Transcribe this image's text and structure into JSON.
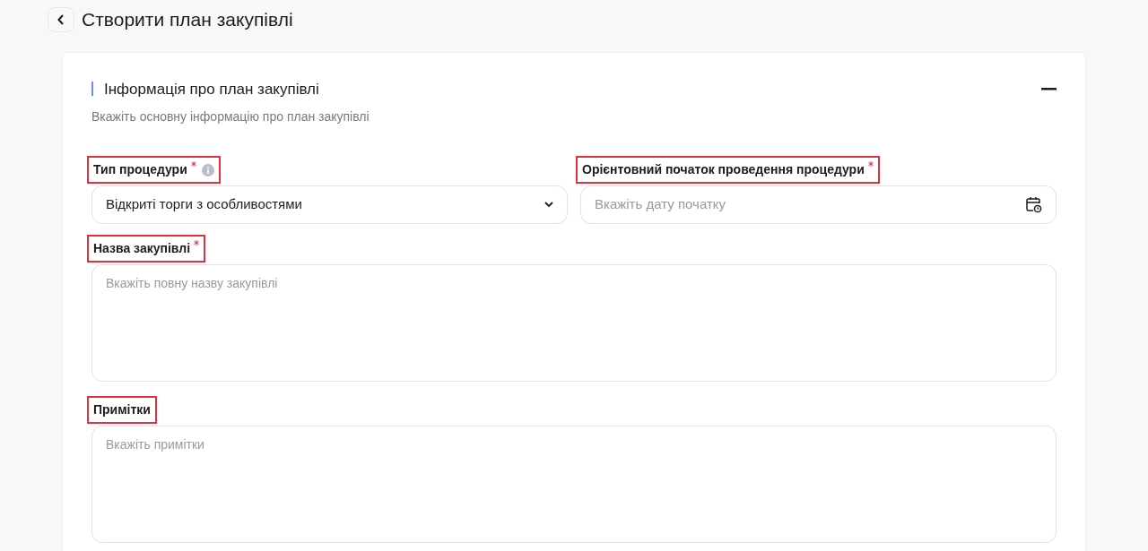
{
  "page": {
    "title": "Створити план закупівлі"
  },
  "section": {
    "title": "Інформація про план закупівлі",
    "subtitle": "Вкажіть основну інформацію про план закупівлі",
    "expanded": true,
    "rows": [
      [
        {
          "kind": "select",
          "label": "Тип процедури",
          "required": true,
          "info": true,
          "highlighted": true,
          "value": "Відкриті торги з особливостями"
        },
        {
          "kind": "date",
          "label": "Орієнтовний початок проведення процедури",
          "required": true,
          "info": false,
          "highlighted": true,
          "placeholder": "Вкажіть дату початку"
        }
      ],
      [
        {
          "kind": "textarea",
          "label": "Назва закупівлі",
          "required": true,
          "info": false,
          "highlighted": true,
          "placeholder": "Вкажіть повну назву закупівлі"
        }
      ],
      [
        {
          "kind": "textarea",
          "label": "Примітки",
          "required": false,
          "info": false,
          "highlighted": true,
          "placeholder": "Вкажіть примітки"
        }
      ]
    ]
  }
}
